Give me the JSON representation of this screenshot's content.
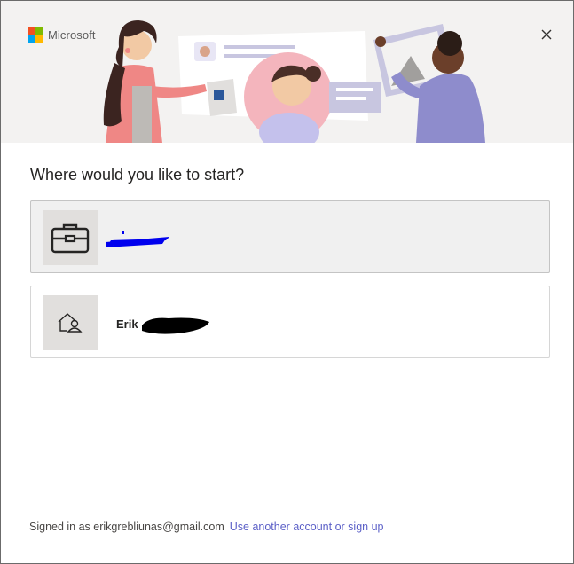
{
  "brand": {
    "logo_text": "Microsoft",
    "colors": [
      "#f25022",
      "#7fba00",
      "#00a4ef",
      "#ffb900"
    ]
  },
  "header": {
    "close_icon": "close-icon"
  },
  "main": {
    "heading": "Where would you like to start?",
    "accounts": [
      {
        "type": "work",
        "icon": "briefcase-icon",
        "name": "",
        "selected": true
      },
      {
        "type": "personal",
        "icon": "home-person-icon",
        "name": "Erik",
        "selected": false
      }
    ]
  },
  "footer": {
    "signed_in_text": "Signed in as erikgrebliunas@gmail.com",
    "link_text": "Use another account or sign up"
  }
}
